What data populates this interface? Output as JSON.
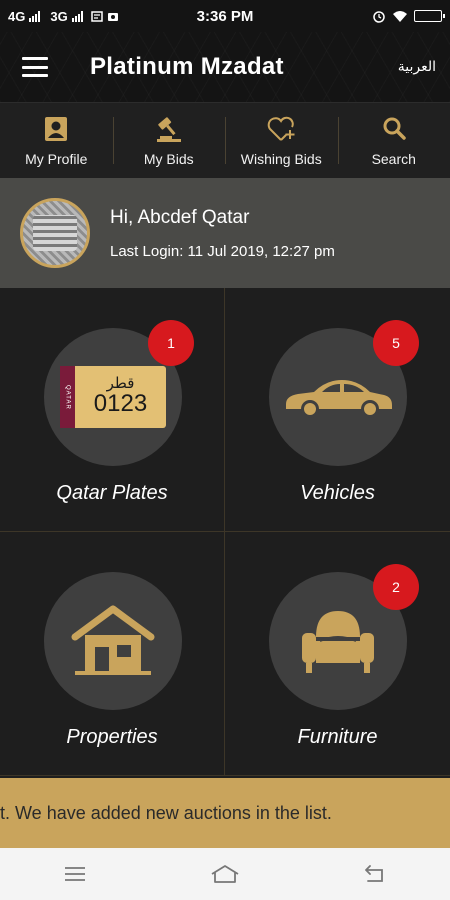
{
  "status_bar": {
    "left": "4G 3G",
    "net1": "4G",
    "net2": "3G",
    "time": "3:36 PM"
  },
  "app_bar": {
    "title": "Platinum Mzadat",
    "language_toggle": "العربية"
  },
  "quick_nav": [
    {
      "label": "My Profile",
      "icon": "profile-icon"
    },
    {
      "label": "My Bids",
      "icon": "gavel-icon"
    },
    {
      "label": "Wishing Bids",
      "icon": "heart-plus-icon"
    },
    {
      "label": "Search",
      "icon": "search-icon"
    }
  ],
  "welcome": {
    "greeting": "Hi, Abcdef Qatar",
    "last_login": "Last Login: 11 Jul 2019, 12:27 pm"
  },
  "categories": [
    {
      "label": "Qatar Plates",
      "badge": "1",
      "icon": "license-plate-icon",
      "plate": {
        "arabic": "قطر",
        "number": "0123",
        "side": "QATAR"
      }
    },
    {
      "label": "Vehicles",
      "badge": "5",
      "icon": "car-icon"
    },
    {
      "label": "Properties",
      "badge": "",
      "icon": "house-icon"
    },
    {
      "label": "Furniture",
      "badge": "2",
      "icon": "armchair-icon"
    }
  ],
  "ticker": {
    "text": "ut.  We have added new auctions in the list."
  },
  "colors": {
    "gold": "#c9a45c",
    "badge_red": "#d7191e",
    "background": "#1c1c1c"
  }
}
